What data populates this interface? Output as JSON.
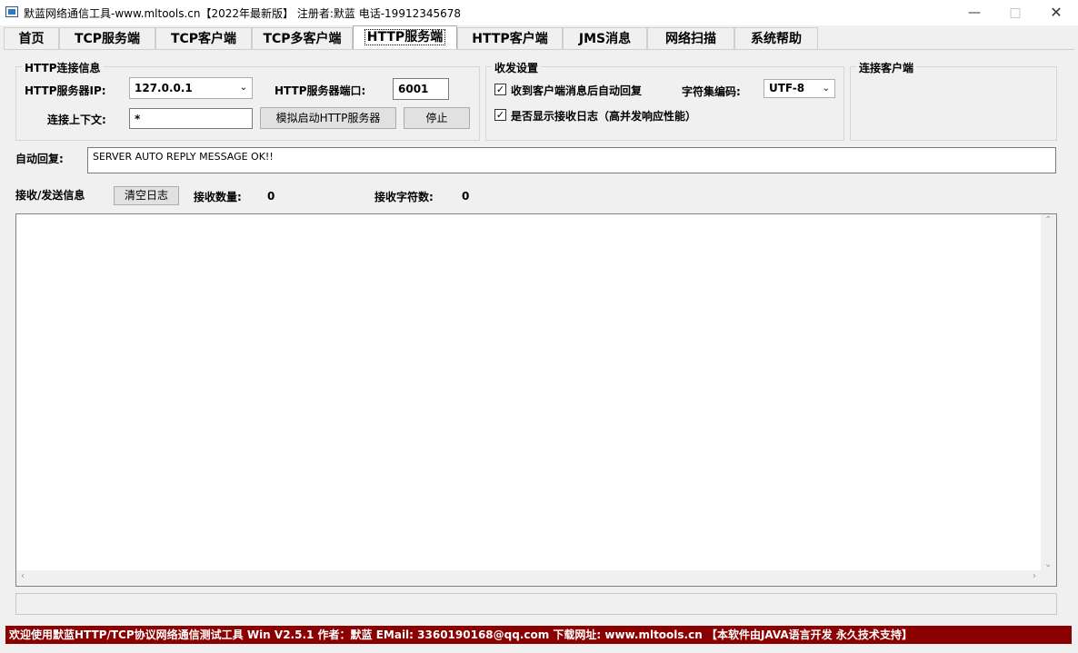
{
  "window": {
    "title": "默蓝网络通信工具-www.mltools.cn【2022年最新版】 注册者:默蓝 电话-19912345678",
    "minimize": "—",
    "maximize": "□",
    "close": "✕"
  },
  "tabs": [
    {
      "label": "首页"
    },
    {
      "label": "TCP服务端"
    },
    {
      "label": "TCP客户端"
    },
    {
      "label": "TCP多客户端"
    },
    {
      "label": "HTTP服务端",
      "active": true
    },
    {
      "label": "HTTP客户端"
    },
    {
      "label": "JMS消息"
    },
    {
      "label": "网络扫描"
    },
    {
      "label": "系统帮助"
    }
  ],
  "http_group": {
    "title": "HTTP连接信息",
    "ip_label": "HTTP服务器IP:",
    "ip_value": "127.0.0.1",
    "port_label": "HTTP服务器端口:",
    "port_value": "6001",
    "context_label": "连接上下文:",
    "context_value": "*",
    "start_button": "模拟启动HTTP服务器",
    "stop_button": "停止"
  },
  "settings_group": {
    "title": "收发设置",
    "auto_reply_check": "收到客户端消息后自动回复",
    "auto_reply_checked": "☑",
    "charset_label": "字符集编码:",
    "charset_value": "UTF-8",
    "show_log_check": "是否显示接收日志（高并发响应性能）",
    "show_log_checked": "☑",
    "check_mark": "✓"
  },
  "clients_group": {
    "title": "连接客户端"
  },
  "auto_reply": {
    "label": "自动回复:",
    "value": "SERVER AUTO REPLY MESSAGE OK!!"
  },
  "log_section": {
    "label": "接收/发送信息",
    "clear_button": "清空日志",
    "count_label": "接收数量:",
    "count_value": "0",
    "chars_label": "接收字符数:",
    "chars_value": "0"
  },
  "footer": {
    "text": "欢迎使用默蓝HTTP/TCP协议网络通信测试工具 Win V2.5.1  作者：默蓝  EMail: 3360190168@qq.com 下载网址: www.mltools.cn  【本软件由JAVA语言开发  永久技术支持】"
  },
  "colors": {
    "footer_bg": "#8b0000",
    "window_bg": "#f0f0f0"
  }
}
